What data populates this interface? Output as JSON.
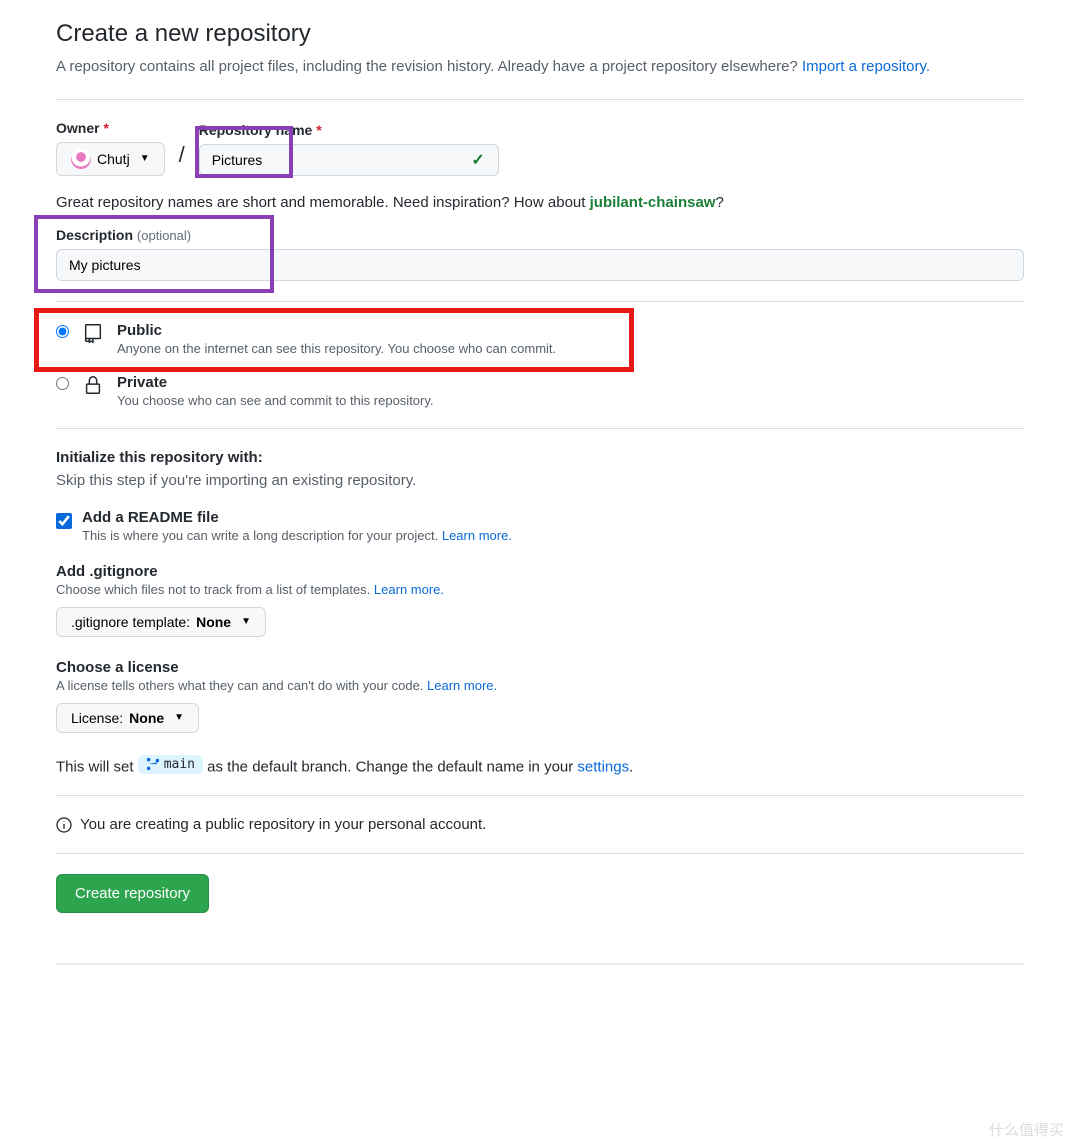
{
  "header": {
    "title": "Create a new repository",
    "subtitle_prefix": "A repository contains all project files, including the revision history. Already have a project repository elsewhere? ",
    "import_link": "Import a repository."
  },
  "owner": {
    "label": "Owner",
    "value": "Chutj"
  },
  "repo_name": {
    "label": "Repository name",
    "value": "Pictures"
  },
  "hint": {
    "prefix": "Great repository names are short and memorable. Need inspiration? How about ",
    "suggestion": "jubilant-chainsaw",
    "suffix": "?"
  },
  "description": {
    "label": "Description",
    "optional": "(optional)",
    "value": "My pictures"
  },
  "visibility": {
    "public": {
      "title": "Public",
      "desc": "Anyone on the internet can see this repository. You choose who can commit."
    },
    "private": {
      "title": "Private",
      "desc": "You choose who can see and commit to this repository."
    }
  },
  "init": {
    "heading": "Initialize this repository with:",
    "sub": "Skip this step if you're importing an existing repository.",
    "readme": {
      "title": "Add a README file",
      "desc": "This is where you can write a long description for your project. ",
      "link": "Learn more."
    },
    "gitignore": {
      "title": "Add .gitignore",
      "desc": "Choose which files not to track from a list of templates. ",
      "link": "Learn more.",
      "selector_prefix": ".gitignore template: ",
      "selector_value": "None"
    },
    "license": {
      "title": "Choose a license",
      "desc": "A license tells others what they can and can't do with your code. ",
      "link": "Learn more.",
      "selector_prefix": "License: ",
      "selector_value": "None"
    }
  },
  "branch": {
    "prefix": "This will set ",
    "name": "main",
    "middle": " as the default branch. Change the default name in your ",
    "link": "settings",
    "suffix": "."
  },
  "info_message": "You are creating a public repository in your personal account.",
  "submit": "Create repository",
  "watermark": "什么值得买"
}
